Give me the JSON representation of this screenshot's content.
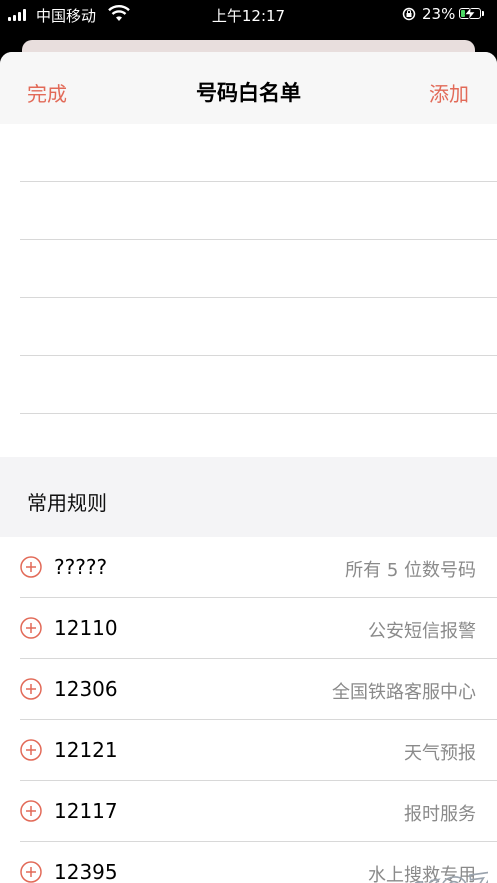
{
  "status_bar": {
    "carrier": "中国移动",
    "time": "上午12:17",
    "battery_percent": "23%",
    "battery_level": 0.23,
    "icons": [
      "signal-icon",
      "wifi-icon",
      "rotation-lock-icon",
      "battery-icon",
      "charging-icon"
    ]
  },
  "nav": {
    "done_label": "完成",
    "title": "号码白名单",
    "add_label": "添加",
    "accent_color": "#e26a58"
  },
  "section": {
    "title": "常用规则"
  },
  "rules": [
    {
      "number": "?????",
      "description": "所有 5 位数号码"
    },
    {
      "number": "12110",
      "description": "公安短信报警"
    },
    {
      "number": "12306",
      "description": "全国铁路客服中心"
    },
    {
      "number": "12121",
      "description": "天气预报"
    },
    {
      "number": "12117",
      "description": "报时服务"
    },
    {
      "number": "12395",
      "description": "水上搜救专用"
    }
  ],
  "watermark": {
    "text": "WOKOZ"
  }
}
